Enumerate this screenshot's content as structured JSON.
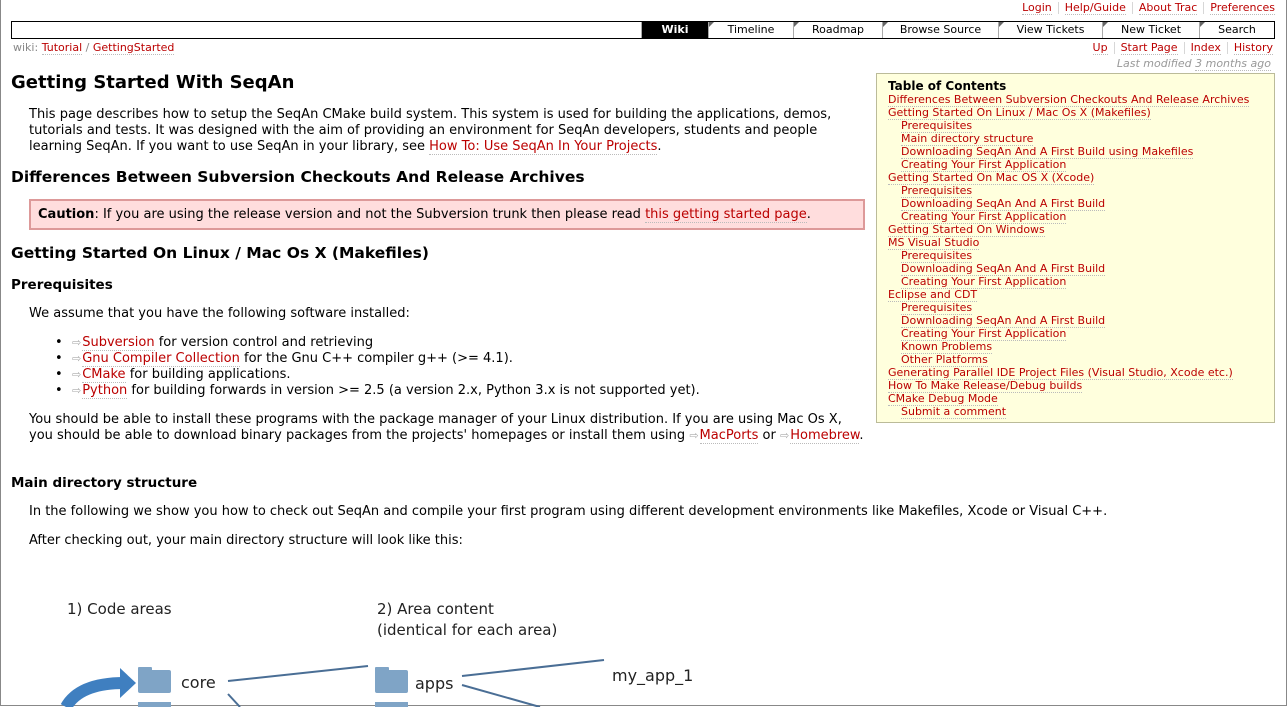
{
  "metanav": [
    "Login",
    "Help/Guide",
    "About Trac",
    "Preferences"
  ],
  "mainnav": [
    "Wiki",
    "Timeline",
    "Roadmap",
    "Browse Source",
    "View Tickets",
    "New Ticket",
    "Search"
  ],
  "breadcrumb": {
    "prefix": "wiki:",
    "items": [
      "Tutorial",
      "GettingStarted"
    ],
    "sep": "/"
  },
  "ctxtnav": [
    "Up",
    "Start Page",
    "Index",
    "History"
  ],
  "last_modified": {
    "label": "Last modified",
    "value": "3 months ago"
  },
  "page": {
    "title": "Getting Started With SeqAn",
    "intro_text": "This page describes how to setup the SeqAn CMake build system. This system is used for building the applications, demos, tutorials and tests. It was designed with the aim of providing an environment for SeqAn developers, students and people learning SeqAn. If you want to use SeqAn in your library, see",
    "intro_link": "How To: Use SeqAn In Your Projects",
    "h_differences": "Differences Between Subversion Checkouts And Release Archives",
    "caution_label": "Caution",
    "caution_text": ": If you are using the release version and not the Subversion trunk then please read",
    "caution_link": "this getting started page",
    "h_linux": "Getting Started On Linux / Mac Os X (Makefiles)",
    "h_prereq": "Prerequisites",
    "prereq_intro": "We assume that you have the following software installed:",
    "software": [
      {
        "link": "Subversion",
        "text": "for version control and retrieving"
      },
      {
        "link": "Gnu Compiler Collection",
        "text": "for the Gnu C++ compiler g++ (>= 4.1)."
      },
      {
        "link": "CMake",
        "text": "for building applications."
      },
      {
        "link": "Python",
        "text": "for building forwards in version >= 2.5 (a version 2.x, Python 3.x is not supported yet)."
      }
    ],
    "install_text1": "You should be able to install these programs with the package manager of your Linux distribution. If you are using Mac Os X, you should be able to download binary packages from the projects' homepages or install them using",
    "install_link1": "MacPorts",
    "install_or": "or",
    "install_link2": "Homebrew",
    "h_main_dir": "Main directory structure",
    "main_dir_text1": "In the following we show you how to check out SeqAn and compile your first program using different development environments like Makefiles, Xcode or Visual C++.",
    "main_dir_text2": "After checking out, your main directory structure will look like this:"
  },
  "toc": {
    "title": "Table of Contents",
    "items": [
      {
        "label": "Differences Between Subversion Checkouts And Release Archives",
        "level": 1
      },
      {
        "label": "Getting Started On Linux / Mac Os X (Makefiles)",
        "level": 1
      },
      {
        "label": "Prerequisites",
        "level": 2
      },
      {
        "label": "Main directory structure",
        "level": 2
      },
      {
        "label": "Downloading SeqAn And A First Build using Makefiles",
        "level": 2
      },
      {
        "label": "Creating Your First Application",
        "level": 2
      },
      {
        "label": "Getting Started On Mac OS X (Xcode)",
        "level": 1
      },
      {
        "label": "Prerequisites",
        "level": 2
      },
      {
        "label": "Downloading SeqAn And A First Build",
        "level": 2
      },
      {
        "label": "Creating Your First Application",
        "level": 2
      },
      {
        "label": "Getting Started On Windows",
        "level": 1
      },
      {
        "label": "MS Visual Studio",
        "level": 1
      },
      {
        "label": "Prerequisites",
        "level": 2
      },
      {
        "label": "Downloading SeqAn And A First Build",
        "level": 2
      },
      {
        "label": "Creating Your First Application",
        "level": 2
      },
      {
        "label": "Eclipse and CDT",
        "level": 1
      },
      {
        "label": "Prerequisites",
        "level": 2
      },
      {
        "label": "Downloading SeqAn And A First Build",
        "level": 2
      },
      {
        "label": "Creating Your First Application",
        "level": 2
      },
      {
        "label": "Known Problems",
        "level": 2
      },
      {
        "label": "Other Platforms",
        "level": 2
      },
      {
        "label": "Generating Parallel IDE Project Files (Visual Studio, Xcode etc.)",
        "level": 1
      },
      {
        "label": "How To Make Release/Debug builds",
        "level": 1
      },
      {
        "label": "CMake Debug Mode",
        "level": 1
      },
      {
        "label": "Submit a comment",
        "level": 2
      }
    ]
  },
  "diagram": {
    "heading1": "1) Code areas",
    "heading2a": "2) Area content",
    "heading2b": "(identical for each area)",
    "folder1": "core",
    "folder2": "apps",
    "item": "my_app_1"
  }
}
